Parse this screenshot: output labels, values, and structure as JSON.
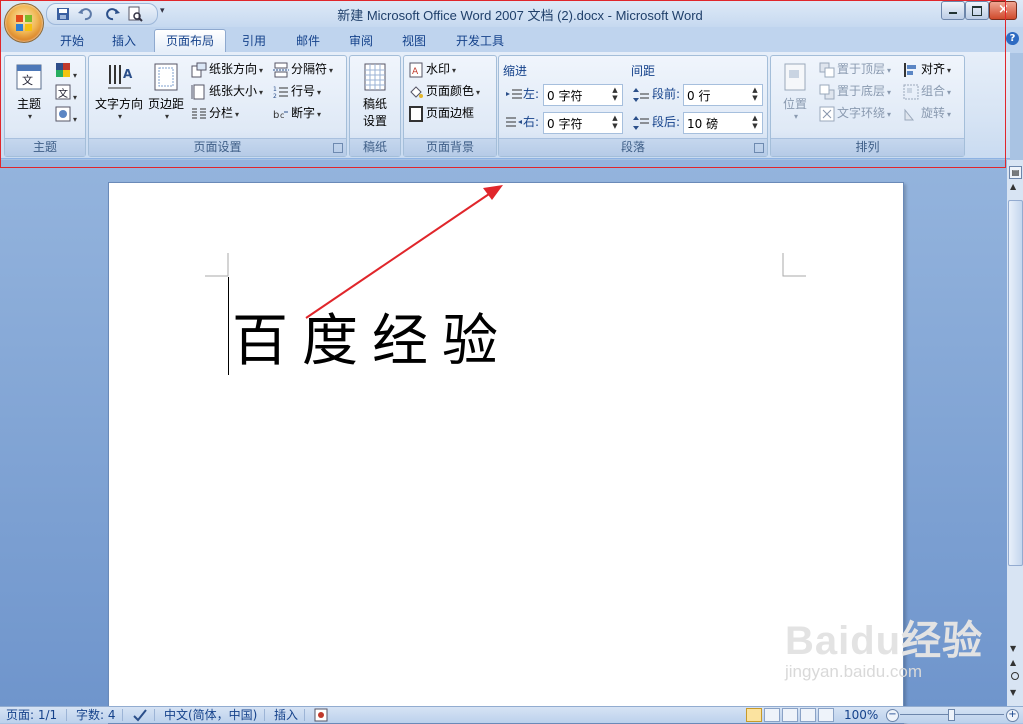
{
  "window": {
    "title": "新建 Microsoft Office Word 2007 文档 (2).docx - Microsoft Word"
  },
  "tabs": [
    "开始",
    "插入",
    "页面布局",
    "引用",
    "邮件",
    "审阅",
    "视图",
    "开发工具"
  ],
  "active_tab": "页面布局",
  "ribbon": {
    "themes": {
      "label": "主题",
      "btn": "主题"
    },
    "page_setup": {
      "label": "页面设置",
      "text_direction": "文字方向",
      "margins": "页边距",
      "orientation": "纸张方向",
      "size": "纸张大小",
      "columns": "分栏",
      "breaks": "分隔符",
      "line_numbers": "行号",
      "hyphenation": "断字"
    },
    "draft_paper": {
      "label": "稿纸",
      "btn_line1": "稿纸",
      "btn_line2": "设置"
    },
    "page_background": {
      "label": "页面背景",
      "watermark": "水印",
      "page_color": "页面颜色",
      "page_borders": "页面边框"
    },
    "paragraph": {
      "label": "段落",
      "indent_title": "缩进",
      "spacing_title": "间距",
      "left_label": "左:",
      "left_value": "0 字符",
      "right_label": "右:",
      "right_value": "0 字符",
      "before_label": "段前:",
      "before_value": "0 行",
      "after_label": "段后:",
      "after_value": "10 磅"
    },
    "arrange": {
      "label": "排列",
      "position": "位置",
      "bring_front": "置于顶层",
      "send_back": "置于底层",
      "text_wrap": "文字环绕",
      "align": "对齐",
      "group": "组合",
      "rotate": "旋转"
    }
  },
  "document": {
    "text": "百度经验"
  },
  "statusbar": {
    "page": "页面: 1/1",
    "words": "字数: 4",
    "language": "中文(简体，中国)",
    "mode": "插入",
    "zoom": "100%"
  },
  "watermark": {
    "line1": "Baidu经验",
    "line2": "jingyan.baidu.com"
  },
  "colors": {
    "accent": "#15428b",
    "annotation": "#e0262b"
  }
}
